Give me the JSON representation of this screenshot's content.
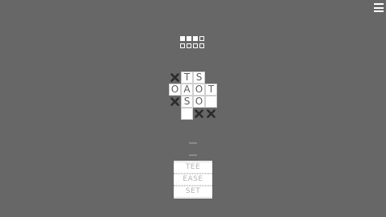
{
  "menu": {
    "icon": "hamburger-menu-icon"
  },
  "progress": {
    "levels": [
      {
        "state": "filled"
      },
      {
        "state": "filled"
      },
      {
        "state": "filled"
      },
      {
        "state": "empty"
      },
      {
        "state": "empty"
      },
      {
        "state": "empty"
      },
      {
        "state": "empty"
      },
      {
        "state": "empty"
      }
    ]
  },
  "board": {
    "cells": [
      {
        "letter": "T"
      },
      {
        "letter": "S"
      },
      {
        "letter": "O"
      },
      {
        "letter": "A"
      },
      {
        "letter": "O"
      },
      {
        "letter": "T"
      },
      {
        "letter": "S"
      },
      {
        "letter": "O"
      },
      {
        "letter": ""
      },
      {
        "letter": ""
      },
      {
        "letter": ""
      }
    ],
    "blocked_icon": "x-mark-icon",
    "colors": {
      "tile": "#ffffff",
      "letter": "#5e5e5e",
      "blocked": "#2b2b2b",
      "background": "#676767"
    }
  },
  "words": [
    {
      "text": "TEE"
    },
    {
      "text": "EASE"
    },
    {
      "text": "SET"
    }
  ]
}
